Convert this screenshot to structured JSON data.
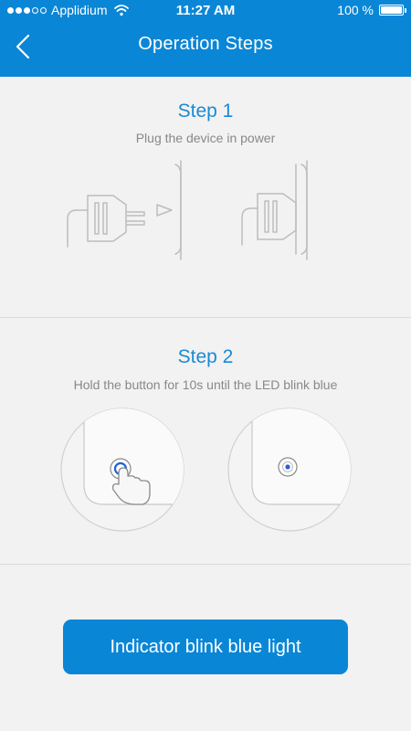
{
  "status": {
    "carrier": "Applidium",
    "time": "11:27 AM",
    "battery": "100 %"
  },
  "nav": {
    "title": "Operation Steps"
  },
  "step1": {
    "title": "Step 1",
    "description": "Plug the device in power"
  },
  "step2": {
    "title": "Step 2",
    "description": "Hold the button for 10s until the LED blink blue"
  },
  "action": {
    "label": "Indicator blink blue light"
  },
  "colors": {
    "accent": "#0a86d6",
    "step_title": "#1a8ad4",
    "background": "#f2f2f2"
  }
}
